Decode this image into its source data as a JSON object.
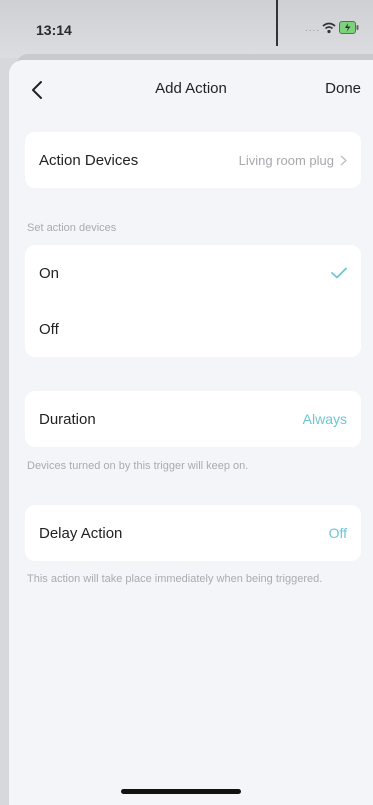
{
  "status_bar": {
    "time": "13:14",
    "signal_dots": "....",
    "icons": [
      "wifi-icon",
      "battery-charging-icon"
    ]
  },
  "nav": {
    "back_icon": "chevron-left-icon",
    "title": "Add Action",
    "done_label": "Done"
  },
  "action_devices": {
    "label": "Action Devices",
    "value": "Living room plug",
    "chevron_icon": "chevron-right-icon"
  },
  "set_action": {
    "caption": "Set action devices",
    "options": [
      {
        "label": "On",
        "selected": true
      },
      {
        "label": "Off",
        "selected": false
      }
    ],
    "check_icon": "checkmark-icon"
  },
  "duration": {
    "label": "Duration",
    "value": "Always",
    "note": "Devices turned on by this trigger will keep on."
  },
  "delay": {
    "label": "Delay Action",
    "value": "Off",
    "note": "This action will take place immediately when being triggered."
  },
  "colors": {
    "accent": "#6fc5d3",
    "background": "#f4f5f8",
    "card": "#ffffff",
    "muted_text": "#a9abb1"
  }
}
